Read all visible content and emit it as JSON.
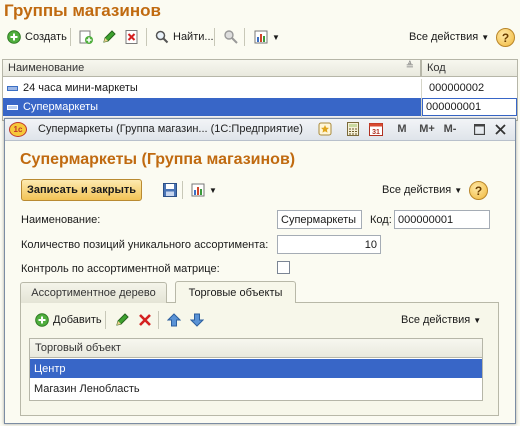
{
  "main_window": {
    "title": "Группы магазинов",
    "toolbar": {
      "create_label": "Создать",
      "find_label": "Найти...",
      "all_actions_label": "Все действия",
      "help_label": "?"
    },
    "table": {
      "columns": [
        "Наименование",
        "Код"
      ],
      "rows": [
        {
          "name": "24 часа мини-маркеты",
          "code": "000000002"
        },
        {
          "name": "Супермаркеты",
          "code": "000000001"
        }
      ]
    }
  },
  "dialog": {
    "window_title": "Супермаркеты (Группа магазин... (1С:Предприятие)",
    "title_buttons": [
      "M",
      "M+",
      "M-"
    ],
    "form_title": "Супермаркеты (Группа магазинов)",
    "save_close_label": "Записать и закрыть",
    "all_actions_label": "Все действия",
    "help_label": "?",
    "fields": {
      "name_label": "Наименование:",
      "name_value": "Супермаркеты",
      "code_label": "Код:",
      "code_value": "000000001",
      "qty_label": "Количество позиций уникального ассортимента:",
      "qty_value": "10",
      "control_label": "Контроль по ассортиментной матрице:",
      "control_checked": false
    },
    "tabs": [
      "Ассортиментное дерево",
      "Торговые объекты"
    ],
    "active_tab": 1,
    "inner_toolbar": {
      "add_label": "Добавить",
      "all_actions_label": "Все действия"
    },
    "inner_table": {
      "column": "Торговый объект",
      "rows": [
        "Центр",
        "Магазин Ленобласть"
      ],
      "selected_row": 0
    }
  },
  "colors": {
    "title_orange": "#c06a10",
    "selection_blue": "#3866c7",
    "selection_text": "#ffffff",
    "window_bg": "#fbfbf2"
  }
}
